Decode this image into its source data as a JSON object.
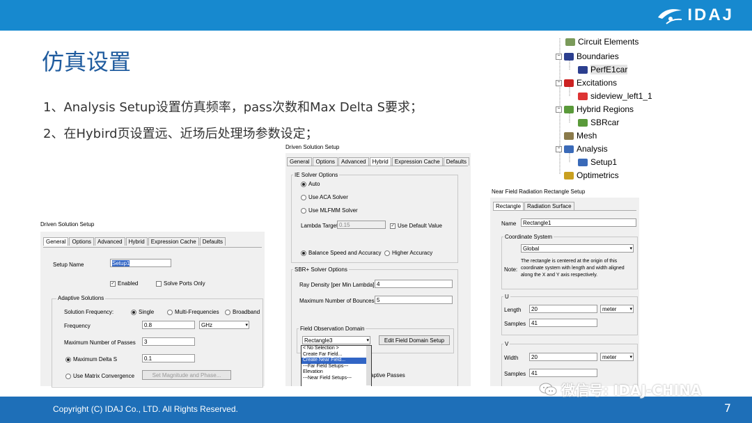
{
  "slide": {
    "title": "仿真设置",
    "bullets": [
      "1、Analysis Setup设置仿真频率，pass次数和Max Delta S要求；",
      "2、在Hybird页设置远、近场后处理场参数设定；"
    ],
    "logo_text": "IDAJ",
    "copyright": "Copyright (C)  IDAJ Co., LTD. All Rights Reserved.",
    "page_number": "7",
    "watermark": "微信号: IDAJ-CHINA"
  },
  "tree": {
    "items": [
      {
        "label": "Circuit Elements",
        "icon": "circuit-icon"
      },
      {
        "label": "Boundaries",
        "icon": "boundaries-icon"
      },
      {
        "label": "PerfE1car",
        "icon": "perfe-boundary-icon"
      },
      {
        "label": "Excitations",
        "icon": "excitations-icon"
      },
      {
        "label": "sideview_left1_1",
        "icon": "excitation-item-icon"
      },
      {
        "label": "Hybrid Regions",
        "icon": "hybrid-regions-icon"
      },
      {
        "label": "SBRcar",
        "icon": "sbr-region-icon"
      },
      {
        "label": "Mesh",
        "icon": "mesh-icon"
      },
      {
        "label": "Analysis",
        "icon": "analysis-icon"
      },
      {
        "label": "Setup1",
        "icon": "setup-icon"
      },
      {
        "label": "Optimetrics",
        "icon": "optimetrics-icon"
      }
    ]
  },
  "dlg1": {
    "title": "Driven Solution Setup",
    "tabs": [
      "General",
      "Options",
      "Advanced",
      "Hybrid",
      "Expression Cache",
      "Defaults"
    ],
    "setup_name_label": "Setup Name",
    "setup_name_value": "Setup1",
    "enabled_label": "Enabled",
    "solve_ports_label": "Solve Ports Only",
    "adaptive_group": "Adaptive Solutions",
    "solution_freq_label": "Solution Frequency:",
    "freq_single": "Single",
    "freq_multi": "Multi-Frequencies",
    "freq_broadband": "Broadband",
    "frequency_label": "Frequency",
    "frequency_value": "0.8",
    "frequency_unit": "GHz",
    "max_passes_label": "Maximum Number of Passes",
    "max_passes_value": "3",
    "max_delta_label": "Maximum Delta S",
    "max_delta_value": "0.1",
    "matrix_conv_label": "Use Matrix Convergence",
    "set_mag_button": "Set Magnitude and Phase..."
  },
  "dlg2": {
    "title": "Driven Solution Setup",
    "tabs": [
      "General",
      "Options",
      "Advanced",
      "Hybrid",
      "Expression Cache",
      "Defaults"
    ],
    "ie_group": "IE Solver Options",
    "auto": "Auto",
    "aca": "Use ACA Solver",
    "mlfmm": "Use MLFMM Solver",
    "lambda_label": "Lambda Target",
    "lambda_value": "0.15",
    "use_default": "Use Default Value",
    "balance": "Balance Speed and Accuracy",
    "higher": "Higher Accuracy",
    "sbr_group": "SBR+ Solver Options",
    "ray_density_label": "Ray Density [per Min Lambda]",
    "ray_density_value": "4",
    "max_bounces_label": "Maximum Number of Bounces",
    "max_bounces_value": "5",
    "field_group": "Field Observation Domain",
    "field_select": "Rectangle3",
    "edit_button": "Edit Field Domain Setup",
    "adaptive_passes_partial": "aptive Passes",
    "dropdown": [
      "< No Selection >",
      "Create Far Field...",
      "Create Near Field...",
      "---Far Field Setups---",
      "Elevation",
      "---Near Field Setups---"
    ],
    "dropdown_highlight_index": 2
  },
  "dlg3": {
    "title": "Near Field Radiation Rectangle Setup",
    "tabs": [
      "Rectangle",
      "Radiation Surface"
    ],
    "name_label": "Name",
    "name_value": "Rectangle1",
    "cs_group": "Coordinate System",
    "cs_value": "Global",
    "note_label": "Note:",
    "note_text": "The rectangle is centered at the origin of this coordinate system with length and width aligned along the X and Y axis respectively.",
    "u_group": "U",
    "length_label": "Length",
    "length_value": "20",
    "length_unit": "meter",
    "u_samples_label": "Samples",
    "u_samples_value": "41",
    "v_group": "V",
    "width_label": "Width",
    "width_value": "20",
    "width_unit": "meter",
    "v_samples_label": "Samples",
    "v_samples_value": "41"
  },
  "colors": {
    "header": "#1789cf",
    "footer": "#1e6fb8",
    "title": "#1f5b9e"
  }
}
